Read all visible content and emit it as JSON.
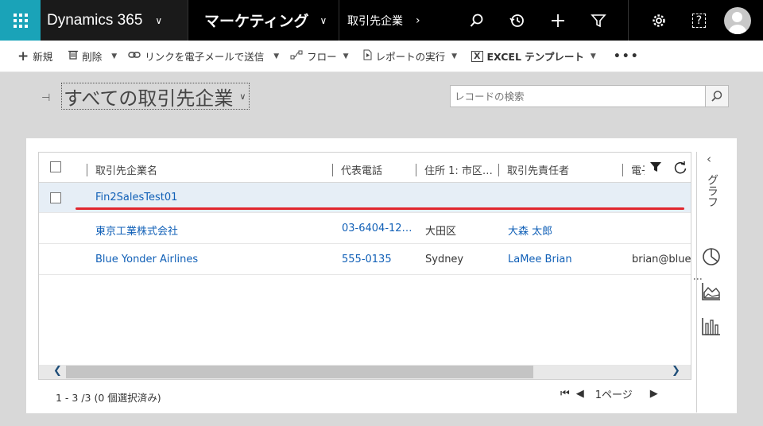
{
  "nav": {
    "brand": "Dynamics 365",
    "module": "マーケティング",
    "breadcrumb": "取引先企業",
    "help_glyph": "?"
  },
  "commands": {
    "new": "新規",
    "delete": "削除",
    "email_link": "リンクを電子メールで送信",
    "flow": "フロー",
    "run_report": "レポートの実行",
    "excel_icon": "X",
    "excel_template": "EXCEL テンプレート",
    "more": "•••"
  },
  "view": {
    "title": "すべての取引先企業",
    "search_placeholder": "レコードの検索"
  },
  "grid": {
    "columns": [
      "取引先企業名",
      "代表電話",
      "住所 1: 市区…",
      "取引先責任者",
      "電子"
    ],
    "rows": [
      {
        "name": "Fin2SalesTest01",
        "phone": "",
        "city": "",
        "contact": "",
        "email": ""
      },
      {
        "name": "東京工業株式会社",
        "phone": "03-6404-12…",
        "city": "大田区",
        "contact": "大森 太郎",
        "email": ""
      },
      {
        "name": "Blue Yonder Airlines",
        "phone": "555-0135",
        "city": "Sydney",
        "contact": "LaMee Brian",
        "email": "brian@bluey"
      }
    ],
    "status": "1 - 3 /3 (0 個選択済み)",
    "page_label": "1ページ"
  },
  "side": {
    "label": "グラフ"
  },
  "colors": {
    "waffle": "#1aa3b8",
    "nav_bg": "#000000",
    "link": "#1160b7",
    "highlight": "#e1262d",
    "selected_row": "#e6eef6"
  }
}
